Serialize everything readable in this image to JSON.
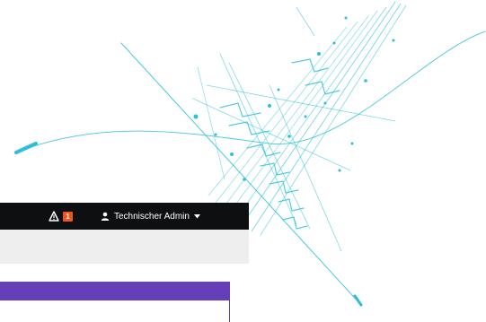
{
  "topbar": {
    "alert_icon": "warning-triangle-icon",
    "alert_count": "1",
    "alert_badge_color": "#f0541e",
    "user_icon": "user-icon",
    "user_name": "Technischer Admin",
    "caret_icon": "caret-down-icon",
    "background_color": "#0d0f10"
  },
  "subbar": {
    "background_color": "#eeeeee"
  },
  "panel": {
    "header_color": "#653fb8"
  },
  "background_art": {
    "accent_color": "#2bc0d8"
  }
}
